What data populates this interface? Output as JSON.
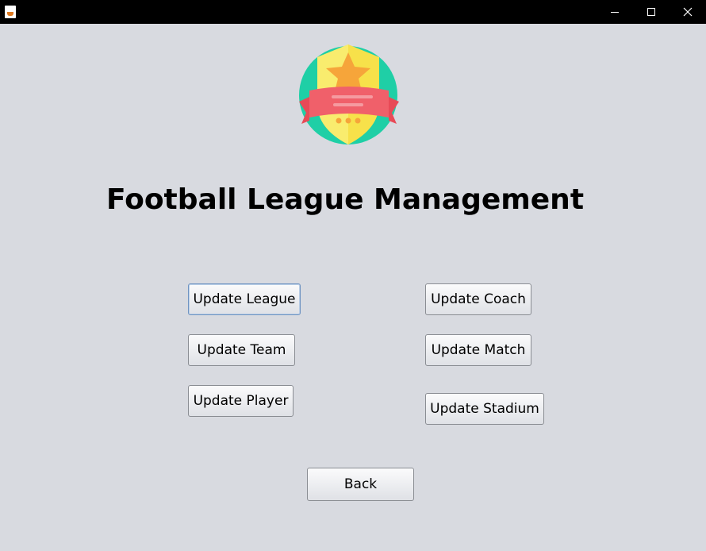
{
  "window": {
    "title": "",
    "controls": [
      "minimize-icon",
      "maximize-icon",
      "close-icon"
    ]
  },
  "logo": {
    "icon": "football-league-badge-icon"
  },
  "heading": "Football League Management",
  "buttons": {
    "update_league": "Update League",
    "update_team": "Update Team",
    "update_player": "Update Player",
    "update_coach": "Update Coach",
    "update_match": "Update Match",
    "update_stadium": "Update Stadium",
    "back": "Back"
  },
  "colors": {
    "background": "#d8dae0",
    "badge_circle": "#1fcfa6",
    "badge_shield": "#f7e14a",
    "badge_star": "#f6a53a",
    "badge_ribbon": "#f0606a"
  }
}
